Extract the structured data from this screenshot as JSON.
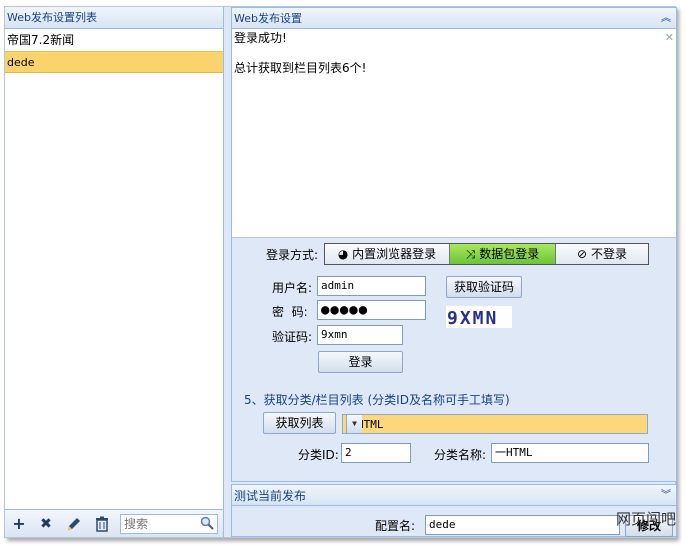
{
  "left_panel": {
    "title": "Web发布设置列表",
    "items": [
      {
        "label": "帝国7.2新闻"
      },
      {
        "label": "dede"
      }
    ],
    "search_placeholder": "搜索"
  },
  "right_panel": {
    "title": "Web发布设置",
    "log_lines": [
      "登录成功!",
      "",
      "总计获取到栏目列表6个!"
    ],
    "login_mode_label": "登录方式:",
    "login_modes": [
      "内置浏览器登录",
      "数据包登录",
      "不登录"
    ],
    "username_label": "用户名:",
    "username_value": "admin",
    "password_label": "密  码:",
    "password_value": "●●●●●",
    "captcha_label": "验证码:",
    "captcha_value": "9xmn",
    "captcha_image_text": "9XMN",
    "get_captcha_button": "获取验证码",
    "login_button": "登录",
    "section_title": "5、获取分类/栏目列表 (分类ID及名称可手工填写)",
    "get_list_button": "获取列表",
    "category_select_value": "一HTML",
    "category_id_label": "分类ID:",
    "category_id_value": "2",
    "category_name_label": "分类名称:",
    "category_name_value": "一HTML"
  },
  "test_panel": {
    "title": "测试当前发布",
    "config_name_label": "配置名:",
    "config_name_value": "dede",
    "save_button": "修改"
  },
  "watermark": "网页闯吧",
  "colors": {
    "selected_row": "#fbd36c",
    "active_segment": "#6cc33a",
    "panel_bg": "#dfe8f6",
    "header_text": "#15428b"
  }
}
